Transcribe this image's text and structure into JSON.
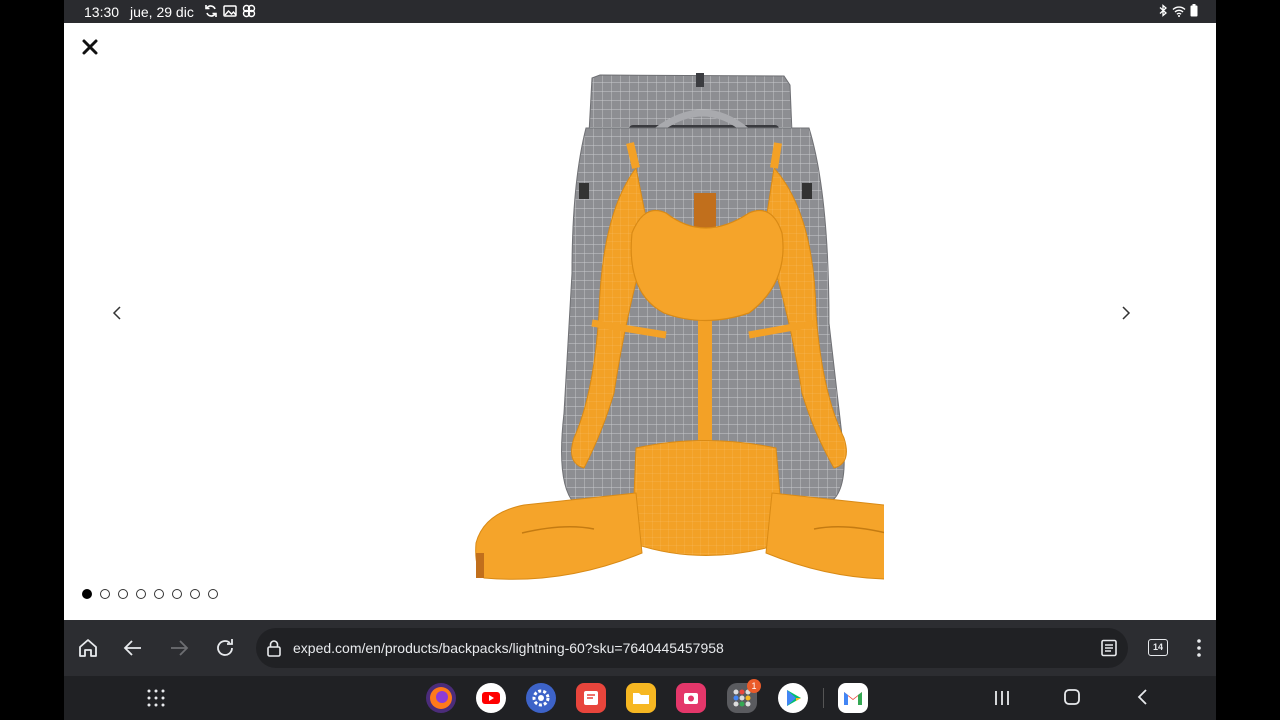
{
  "status_bar": {
    "time": "13:30",
    "date": "jue, 29 dic"
  },
  "viewer": {
    "close_icon": "close-icon",
    "prev_icon": "chevron-left-icon",
    "next_icon": "chevron-right-icon",
    "image_count": 8,
    "active_index": 0,
    "product_colors": {
      "fabric": "#8f9094",
      "accent": "#f5a42a"
    }
  },
  "browser": {
    "url": "exped.com/en/products/backpacks/lightning-60?sku=7640445457958",
    "tab_count": "14"
  },
  "dock": {
    "apps": [
      "firefox-icon",
      "youtube-icon",
      "settings-icon",
      "keep-icon",
      "files-icon",
      "camera-icon",
      "apps-folder-icon",
      "play-store-icon",
      "gmail-icon"
    ],
    "apps_badge": "1"
  }
}
